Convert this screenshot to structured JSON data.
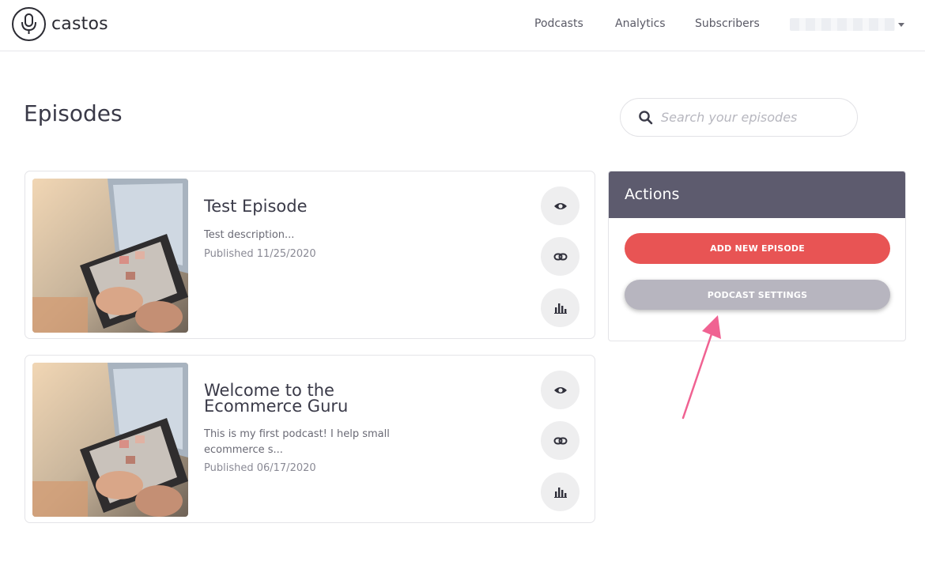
{
  "app": {
    "logo_text": "castos"
  },
  "nav": {
    "items": [
      "Podcasts",
      "Analytics",
      "Subscribers"
    ]
  },
  "page": {
    "title": "Episodes"
  },
  "search": {
    "placeholder": "Search your episodes"
  },
  "episodes": [
    {
      "title": "Test Episode",
      "description": "Test description...",
      "published": "Published 11/25/2020"
    },
    {
      "title": "Welcome to the Ecommerce Guru",
      "description": "This is my first podcast! I help small ecommerce s...",
      "published": "Published 06/17/2020"
    }
  ],
  "actions": {
    "title": "Actions",
    "add_new_episode": "ADD NEW EPISODE",
    "podcast_settings": "PODCAST SETTINGS"
  },
  "icons": {
    "logo": "microphone-icon",
    "view": "eye-icon",
    "link": "link-icon",
    "stats": "bar-chart-icon",
    "search": "search-icon",
    "account_menu": "caret-down-icon"
  },
  "colors": {
    "actions_header": "#5d5b6e",
    "primary_button": "#e85454",
    "secondary_button": "#b7b5bf",
    "annotation_arrow": "#f06292"
  }
}
